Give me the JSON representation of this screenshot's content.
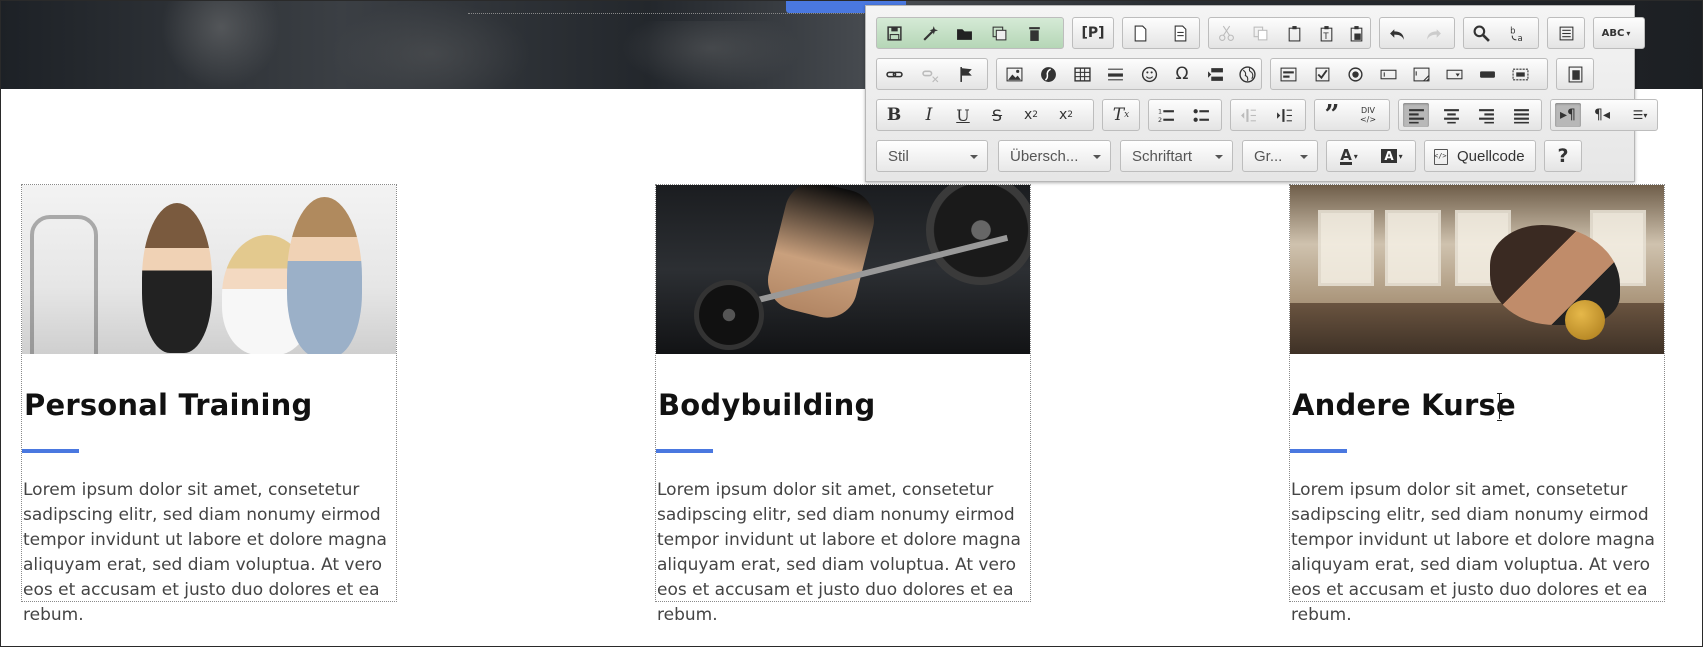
{
  "cards": [
    {
      "title": "Personal Training",
      "text": "Lorem ipsum dolor sit amet, consetetur sadipscing elitr, sed diam nonumy eirmod tempor invidunt ut labore et dolore magna aliquyam erat, sed diam voluptua. At vero eos et accusam et justo duo dolores et ea rebum."
    },
    {
      "title": "Bodybuilding",
      "text": "Lorem ipsum dolor sit amet, consetetur sadipscing elitr, sed diam nonumy eirmod tempor invidunt ut labore et dolore magna aliquyam erat, sed diam voluptua. At vero eos et accusam et justo duo dolores et ea rebum."
    },
    {
      "title": "Andere Kurse",
      "text": "Lorem ipsum dolor sit amet, consetetur sadipscing elitr, sed diam nonumy eirmod tempor invidunt ut labore et dolore magna aliquyam erat, sed diam voluptua. At vero eos et accusam et justo duo dolores et ea rebum."
    }
  ],
  "toolbar": {
    "style_combo": "Stil",
    "heading_combo": "Übersch...",
    "font_combo": "Schriftart",
    "size_combo": "Gr...",
    "source_label": "Quellcode",
    "help_label": "?",
    "placeholder_label": "[P]",
    "div_label": "DIV",
    "spellcheck_label": "ABC"
  },
  "colors": {
    "accent": "#4a78e0",
    "toolbar_bg": "#ececec"
  }
}
